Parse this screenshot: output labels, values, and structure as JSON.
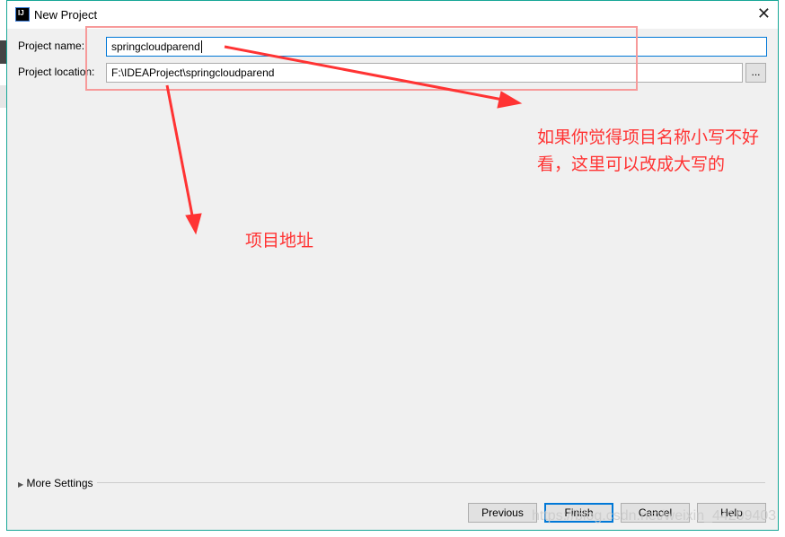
{
  "dialog": {
    "title": "New Project",
    "logo": "IJ"
  },
  "form": {
    "name_label": "Project name:",
    "name_value": "springcloudparend",
    "location_label": "Project location:",
    "location_value": "F:\\IDEAProject\\springcloudparend",
    "browse_label": "..."
  },
  "more_settings": "More Settings",
  "buttons": {
    "previous": "Previous",
    "finish": "Finish",
    "cancel": "Cancel",
    "help": "Help"
  },
  "annotations": {
    "name_note": "如果你觉得项目名称小写不好看，这里可以改成大写的",
    "location_note": "项目地址",
    "color": "#ff3333"
  },
  "watermark": "https://blog.csdn.net/weixin_44209403"
}
